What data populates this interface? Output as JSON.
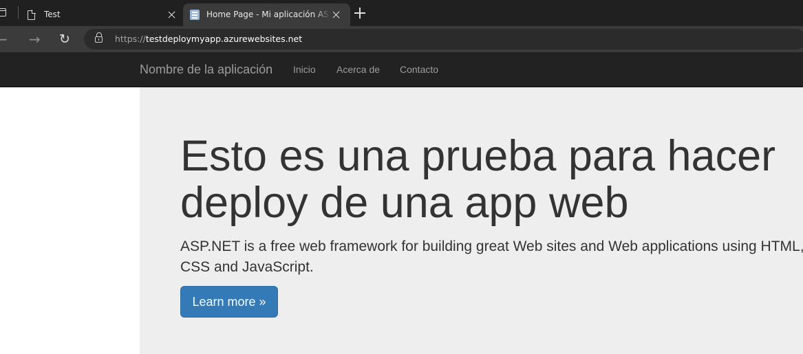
{
  "browser": {
    "tabs": [
      {
        "title": "Test",
        "active": false
      },
      {
        "title": "Home Page - Mi aplicación ASP.NET",
        "active": true
      }
    ],
    "address_bar": {
      "scheme": "https://",
      "host": "testdeploymyapp.azurewebsites.net"
    },
    "icons": [
      "tab-actions-icon",
      "page-icon",
      "close-icon",
      "favicon",
      "new-tab-icon",
      "back-icon",
      "forward-icon",
      "refresh-icon",
      "lock-icon"
    ]
  },
  "site": {
    "navbar": {
      "brand": "Nombre de la aplicación",
      "links": [
        "Inicio",
        "Acerca de",
        "Contacto"
      ]
    },
    "jumbotron": {
      "title": "Esto es una prueba para hacer deploy de una app web",
      "lead": "ASP.NET is a free web framework for building great Web sites and Web applications using HTML, CSS and JavaScript.",
      "button_label": "Learn more »"
    }
  },
  "colors": {
    "navbar_bg": "#222222",
    "navbar_text": "#9d9d9d",
    "jumbotron_bg": "#eeeeee",
    "primary_button": "#337ab7"
  }
}
